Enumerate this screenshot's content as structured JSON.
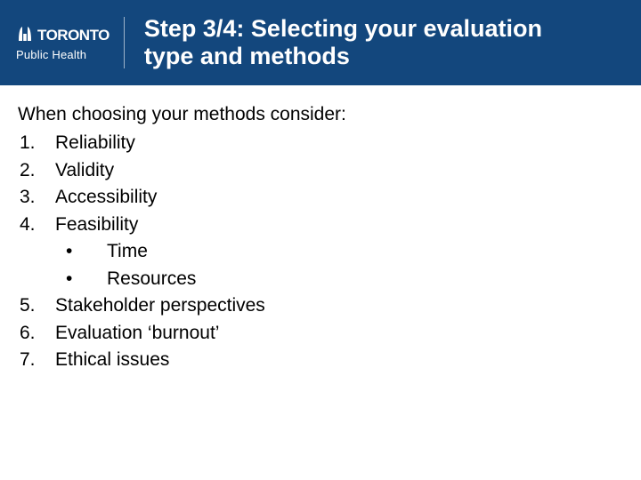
{
  "header": {
    "logo": {
      "city": "TORONTO",
      "subtitle": "Public Health"
    },
    "title": "Step 3/4: Selecting your evaluation type and methods"
  },
  "content": {
    "intro": "When choosing your methods consider:",
    "items": [
      {
        "num": "1.",
        "text": "Reliability",
        "sub": []
      },
      {
        "num": "2.",
        "text": "Validity",
        "sub": []
      },
      {
        "num": "3.",
        "text": "Accessibility",
        "sub": []
      },
      {
        "num": "4.",
        "text": "Feasibility",
        "sub": [
          "Time",
          "Resources"
        ]
      },
      {
        "num": "5.",
        "text": "Stakeholder perspectives",
        "sub": []
      },
      {
        "num": "6.",
        "text": "Evaluation ‘burnout’",
        "sub": []
      },
      {
        "num": "7.",
        "text": "Ethical issues",
        "sub": []
      }
    ]
  }
}
